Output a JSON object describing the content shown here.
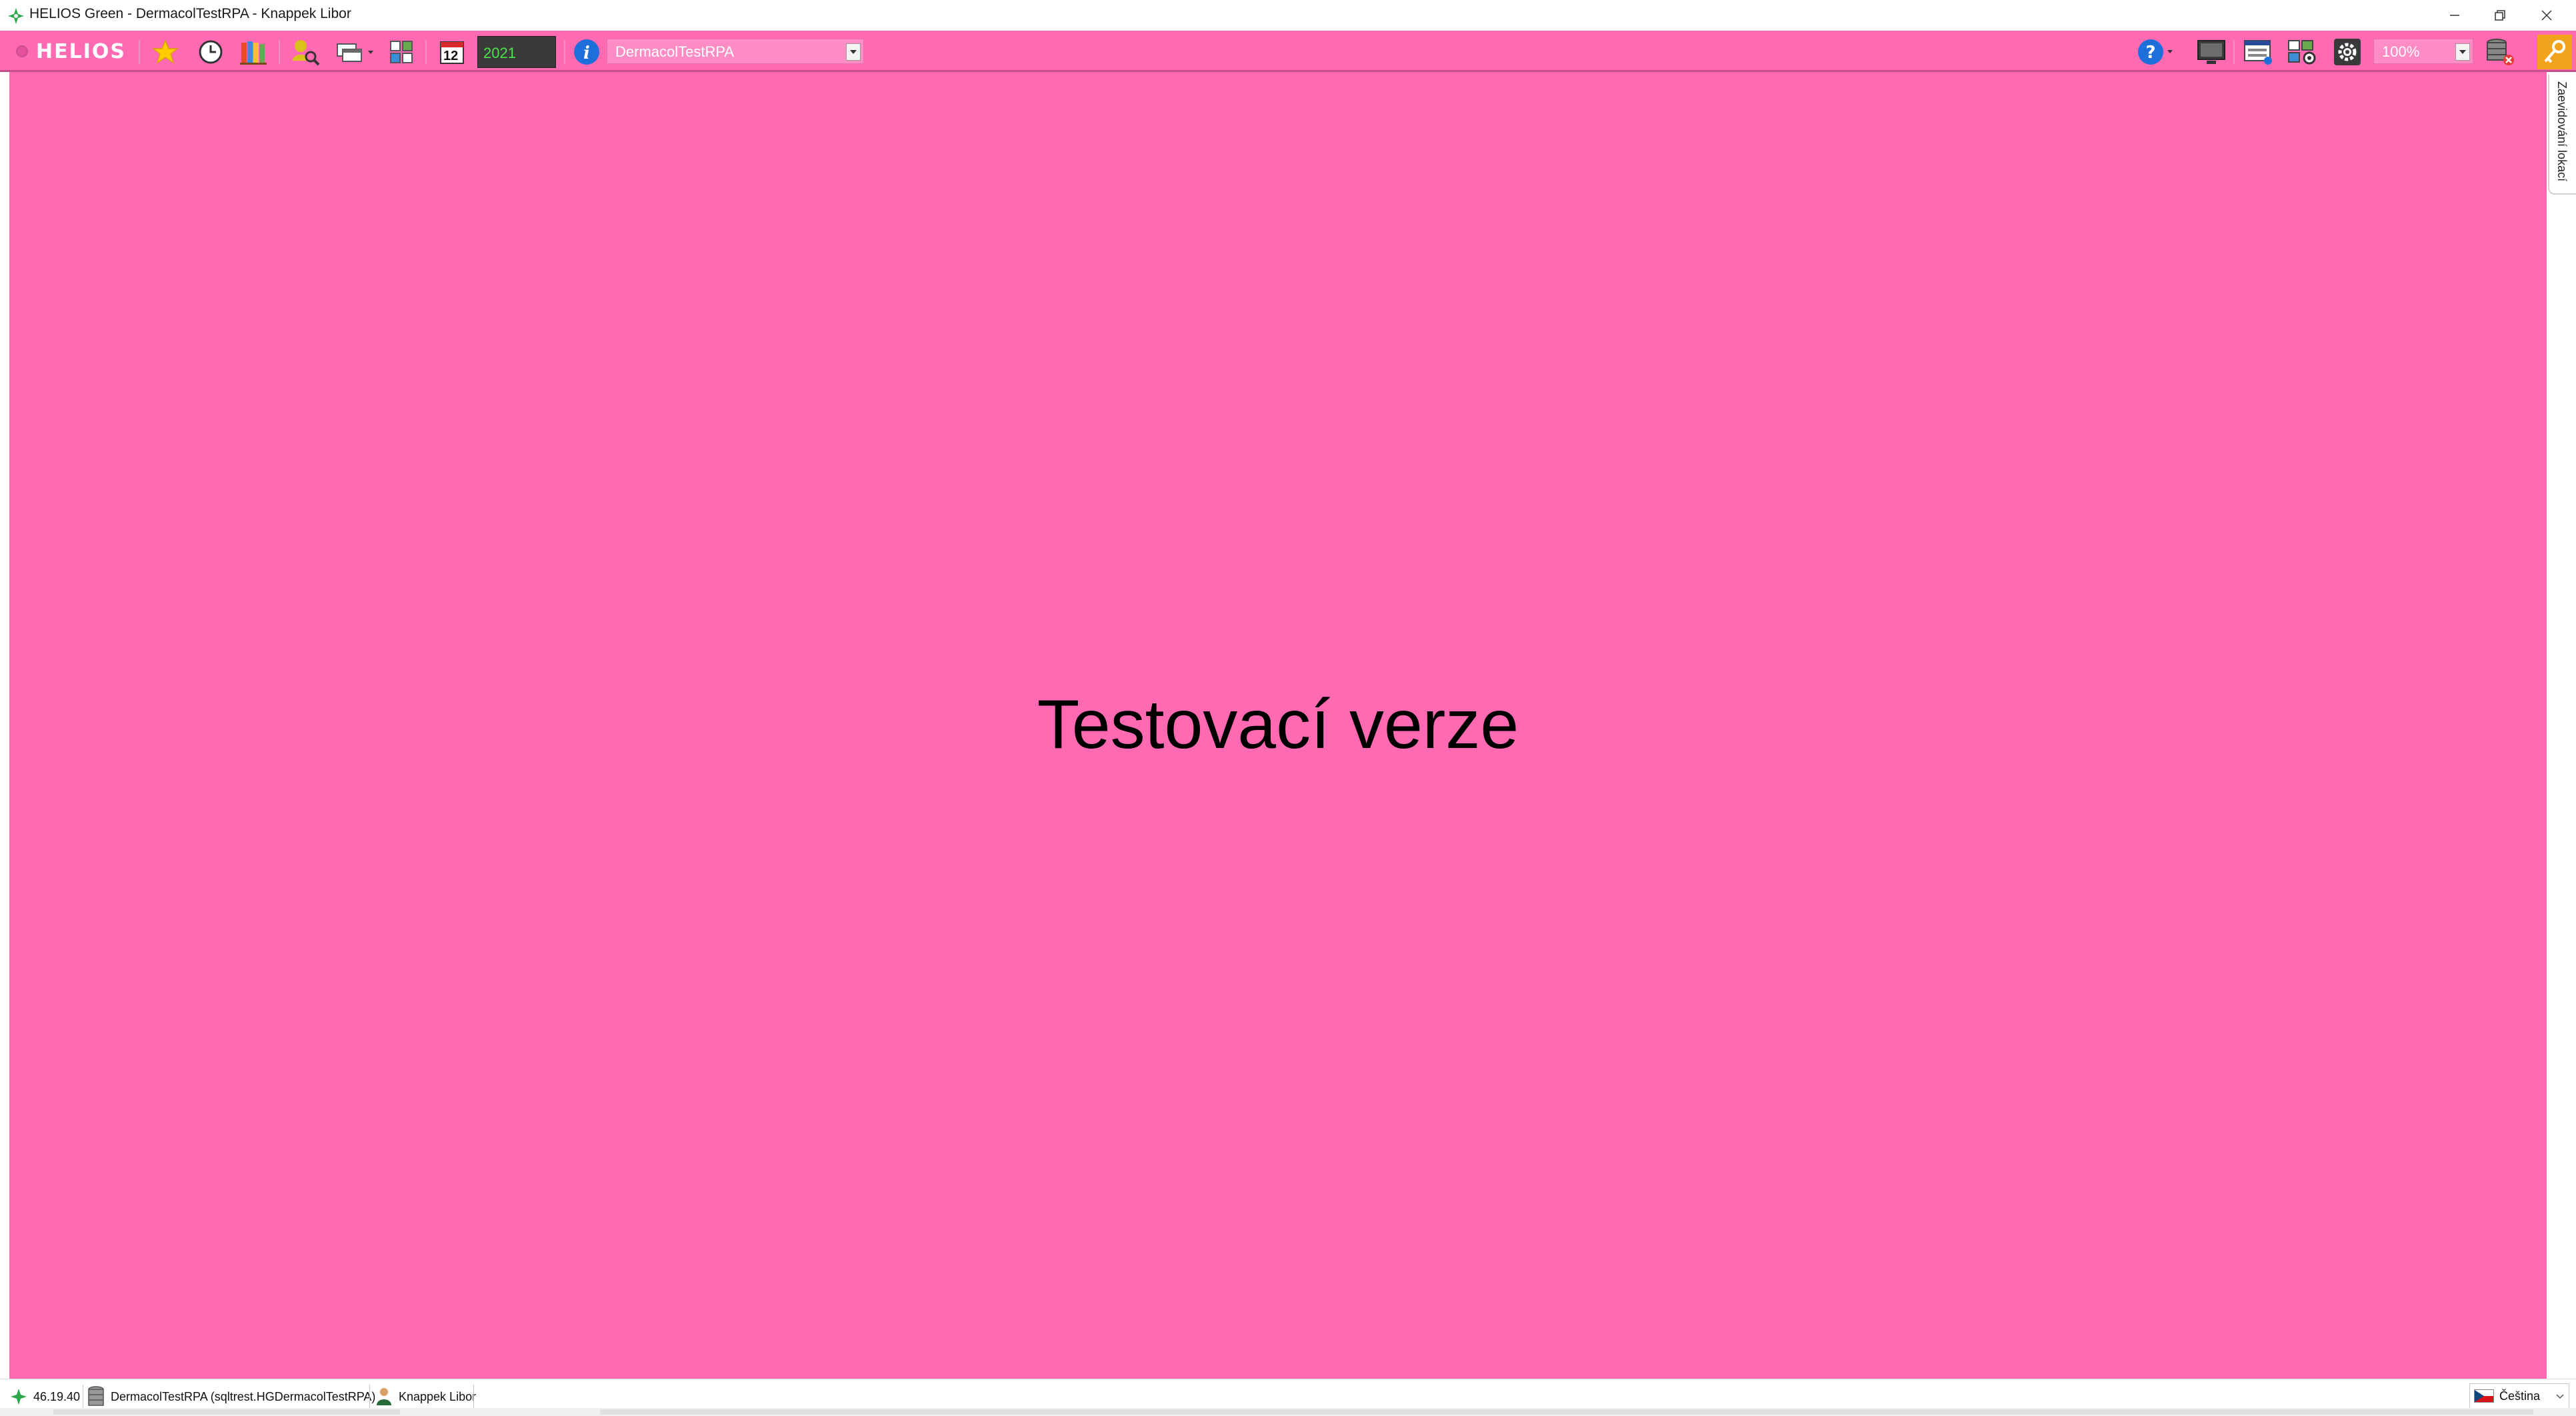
{
  "window": {
    "title": "HELIOS Green - DermacolTestRPA - Knappek Libor"
  },
  "toolbar": {
    "logo_text": "HELIOS",
    "calendar_day": "12",
    "year": "2021",
    "database": "DermacolTestRPA",
    "zoom": "100%",
    "background_color": "#ff6ab3",
    "icons": [
      "favorites-star-icon",
      "history-clock-icon",
      "books-icon",
      "search-user-icon",
      "windows-icon",
      "grid-icon",
      "calendar-icon",
      "info-icon",
      "help-icon",
      "monitor-icon",
      "layout-icon",
      "settings-icon",
      "gear-icon",
      "database-disconnect-icon",
      "key-icon"
    ]
  },
  "main": {
    "watermark": "Testovací verze",
    "side_tab": "Zaevidování lokací"
  },
  "statusbar": {
    "version": "46.19.40",
    "connection": "DermacolTestRPA (sqltrest.HGDermacolTestRPA)",
    "user": "Knappek Libor",
    "language": "Čeština"
  }
}
